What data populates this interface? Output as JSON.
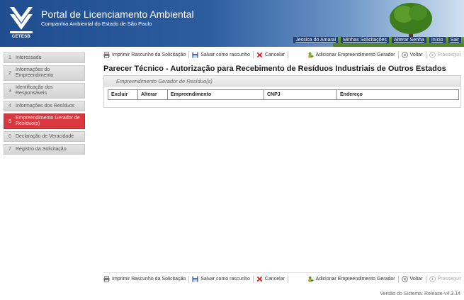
{
  "header": {
    "logo_text": "CETESB",
    "title": "Portal de Licenciamento Ambiental",
    "subtitle": "Companhia Ambiental do Estado de São Paulo",
    "user_links": [
      "Jessica do Amaral",
      "Minhas Solicitações",
      "Alterar Senha",
      "Início",
      "Sair"
    ]
  },
  "sidebar": {
    "steps": [
      {
        "num": "1",
        "label": "Interessado"
      },
      {
        "num": "2",
        "label": "Informações do Empreendimento"
      },
      {
        "num": "3",
        "label": "Identificação dos Responsáveis"
      },
      {
        "num": "4",
        "label": "Informações dos Resíduos"
      },
      {
        "num": "5",
        "label": "Empreendimento Gerador de Resíduo(s)"
      },
      {
        "num": "6",
        "label": "Declaração de Veracidade"
      },
      {
        "num": "7",
        "label": "Registro da Solicitação"
      }
    ]
  },
  "toolbar": {
    "print_label": "Imprimir Rascunho da Solicitação",
    "save_label": "Salvar como rascunho",
    "cancel_label": "Cancelar",
    "add_label": "Adicionar Empreendimento Gerador",
    "back_label": "Voltar",
    "next_label": "Prosseguir"
  },
  "main": {
    "page_title": "Parecer Técnico - Autorização para Recebimento de Resíduos Industriais de Outros Estados",
    "panel_title": "Empreendimento Gerador de Resíduo(s)",
    "table_headers": [
      "Excluir",
      "Alterar",
      "Empreendimento",
      "CNPJ",
      "Endereço"
    ]
  },
  "footer": {
    "version": "Versão do Sistema: Release-v4.3.14"
  },
  "colors": {
    "header_blue": "#1f4d8f",
    "active_step": "#d9383f"
  }
}
